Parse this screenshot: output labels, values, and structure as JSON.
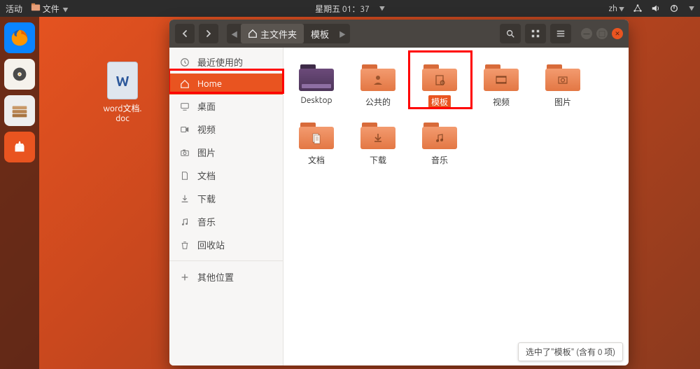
{
  "topbar": {
    "activities": "活动",
    "app_menu": "文件",
    "clock": "星期五 01：37",
    "input_method": "zh"
  },
  "desktop": {
    "word_doc_label": "word文档.\ndoc",
    "word_letter": "W"
  },
  "titlebar": {
    "path_home_label": "主文件夹",
    "path_templates_label": "模板"
  },
  "sidebar": {
    "recent": "最近使用的",
    "home": "Home",
    "desktop": "桌面",
    "videos": "视频",
    "pictures": "图片",
    "documents": "文档",
    "downloads": "下载",
    "music": "音乐",
    "trash": "回收站",
    "other": "其他位置"
  },
  "content": {
    "items": [
      {
        "label": "Desktop",
        "type": "desktop"
      },
      {
        "label": "公共的",
        "type": "public"
      },
      {
        "label": "模板",
        "type": "templates",
        "selected": true
      },
      {
        "label": "视频",
        "type": "videos"
      },
      {
        "label": "图片",
        "type": "pictures"
      },
      {
        "label": "文档",
        "type": "documents"
      },
      {
        "label": "下载",
        "type": "downloads"
      },
      {
        "label": "音乐",
        "type": "music"
      }
    ]
  },
  "statusbar": {
    "text": "选中了\"模板\" (含有 0 项)"
  }
}
